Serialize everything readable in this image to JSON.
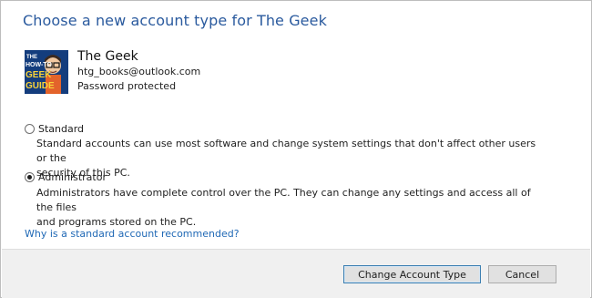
{
  "dialog": {
    "title": "Choose a new account type for The Geek"
  },
  "user": {
    "name": "The Geek",
    "email": "htg_books@outlook.com",
    "status": "Password protected",
    "avatar_icon": "how-to-geek-guide-icon",
    "avatar_text": [
      "THE",
      "HOW-TO",
      "GEEK",
      "GUIDE"
    ]
  },
  "options": [
    {
      "label": "Standard",
      "selected": false,
      "description_line1": "Standard accounts can use most software and change system settings that don't affect other users or the",
      "description_line2": "security of this PC."
    },
    {
      "label": "Administrator",
      "selected": true,
      "description_line1": "Administrators have complete control over the PC. They can change any settings and access all of the files",
      "description_line2": "and programs stored on the PC."
    }
  ],
  "help_link": "Why is a standard account recommended?",
  "buttons": {
    "change": "Change Account Type",
    "cancel": "Cancel"
  },
  "colors": {
    "title": "#2a5a9e",
    "link": "#1f68b5",
    "footer_bg": "#f0f0f0",
    "primary_border": "#3c7fb1"
  }
}
